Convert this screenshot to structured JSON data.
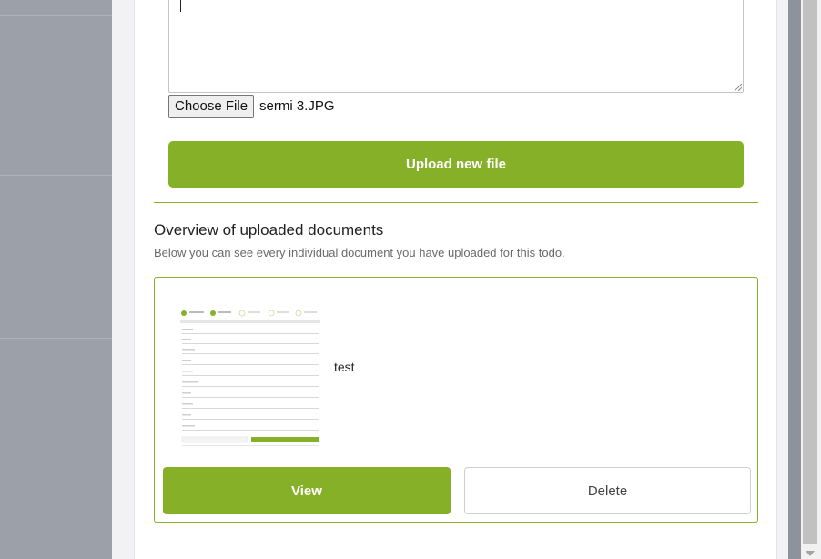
{
  "file_input": {
    "button_label": "Choose File",
    "selected_file": "sermi 3.JPG"
  },
  "upload": {
    "button_label": "Upload new file"
  },
  "overview": {
    "title": "Overview of uploaded documents",
    "subtitle": "Below you can see every individual document you have uploaded for this todo."
  },
  "documents": [
    {
      "name": "test",
      "view_label": "View",
      "delete_label": "Delete"
    }
  ],
  "colors": {
    "accent": "#86b027",
    "overlay": "#8d929c"
  }
}
